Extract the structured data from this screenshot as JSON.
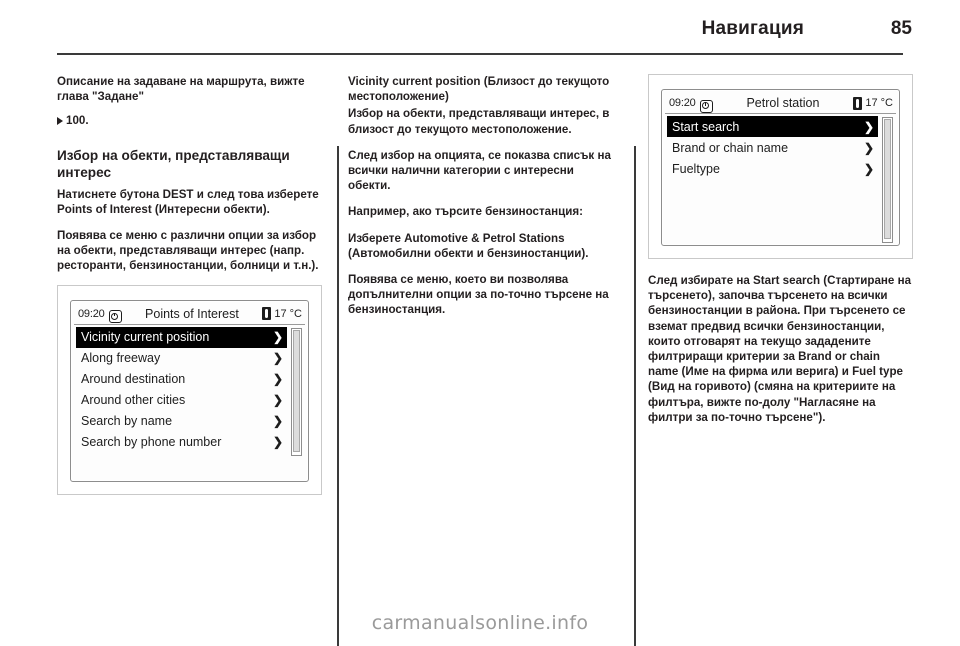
{
  "header": {
    "title": "Навигация",
    "page_number": "85"
  },
  "footer": {
    "watermark": "carmanualsonline.info"
  },
  "columns": {
    "col1": {
      "p_intro": "Описание на задаване на маршрута, вижте глава \"Задане\"",
      "ref_page": "100.",
      "h_select_poi": "Избор на обекти, представляващи интерес",
      "p_press_dest": "Натиснете бутона DEST и след това изберете Points of Interest (Интересни обекти).",
      "p_menu_options": "Появява се меню с различни опции за избор на обекти, представляващи интерес (напр. ресторанти, бензиностанции, болници и т.н.)."
    },
    "col2": {
      "h_vicinity": "Vicinity current position (Близост до текущото местоположение)",
      "p_vicinity": "Избор на обекти, представляващи интерес, в близост до текущото местоположение.",
      "p_after_select": "След избор на опцията, се показва списък на всички налични категории с интересни обекти.",
      "p_example": "Например, ако търсите бензиностанция:",
      "p_choose_auto": "Изберете Automotive & Petrol Stations (Автомобилни обекти и бензиностанции).",
      "p_submenu": "Появява се меню, което ви позволява допълнителни опции за по-точно търсене на бензиностанция."
    },
    "col3": {
      "p_start_search": "След избирате на Start search (Стартиране на търсенето), започва търсенето на всички бензиностанции в района. При търсенето се вземат предвид всички бензиностанции, които отговарят на текущо зададените филтриращи критерии за Brand or chain name (Име на фирма или верига) и Fuel type (Вид на горивото) (смяна на критериите на филтъра, вижте по-долу \"Нагласяне на филтри за по-точно търсене\")."
    }
  },
  "screenshots": {
    "poi": {
      "clock": "09:20",
      "title": "Points of Interest",
      "temperature": "17 °C",
      "clock_icon": "clock-icon",
      "thermometer_icon": "thermometer-icon",
      "rows": [
        {
          "label": "Vicinity current position",
          "chevron": "❯",
          "selected": true
        },
        {
          "label": "Along freeway",
          "chevron": "❯",
          "selected": false
        },
        {
          "label": "Around destination",
          "chevron": "❯",
          "selected": false
        },
        {
          "label": "Around other cities",
          "chevron": "❯",
          "selected": false
        },
        {
          "label": "Search by name",
          "chevron": "❯",
          "selected": false
        },
        {
          "label": "Search by phone number",
          "chevron": "❯",
          "selected": false
        }
      ]
    },
    "petrol": {
      "clock": "09:20",
      "title": "Petrol station",
      "temperature": "17 °C",
      "clock_icon": "clock-icon",
      "thermometer_icon": "thermometer-icon",
      "rows": [
        {
          "label": "Start search",
          "chevron": "❯",
          "selected": true
        },
        {
          "label": "Brand or chain name",
          "chevron": "❯",
          "selected": false
        },
        {
          "label": "Fueltype",
          "chevron": "❯",
          "selected": false
        }
      ]
    }
  }
}
